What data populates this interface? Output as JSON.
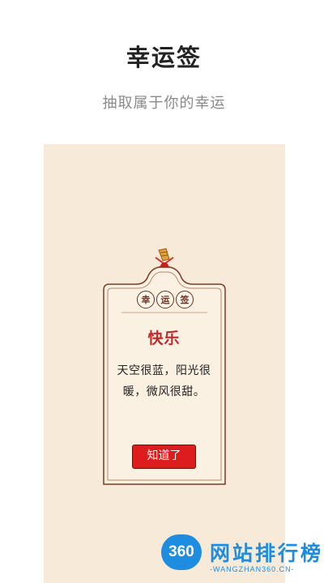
{
  "header": {
    "title": "幸运签",
    "subtitle": "抽取属于你的幸运"
  },
  "card": {
    "seal_chars": [
      "幸",
      "运",
      "签"
    ],
    "fortune_title": "快乐",
    "fortune_lines": [
      "天空很蓝，阳光很",
      "暖，微风很甜。"
    ],
    "button_label": "知道了"
  },
  "watermark": {
    "logo_text": "360",
    "name": "网站排行榜",
    "domain": "-WANGZHAN360.CN-"
  },
  "colors": {
    "background": "#ffffff",
    "panel": "#f8ead8",
    "accent_red": "#dd1d1d",
    "title_red": "#c0292a",
    "border_brown": "#6b2e1e",
    "watermark_blue": "#1e8de0"
  }
}
